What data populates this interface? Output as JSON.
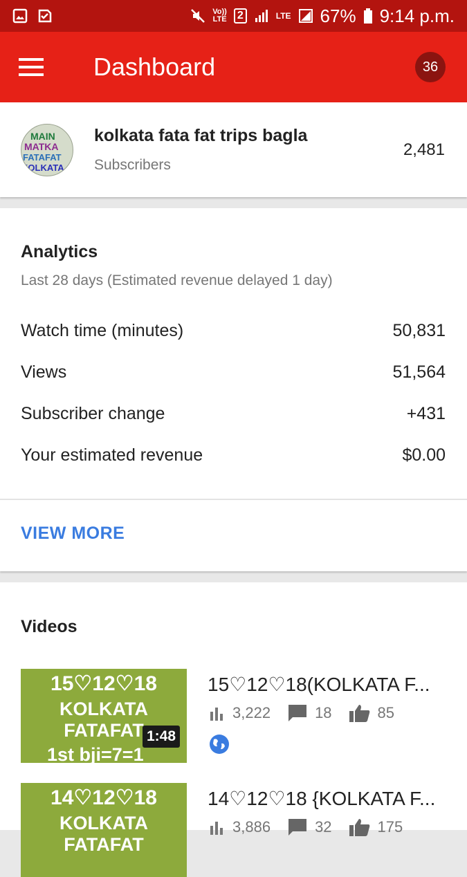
{
  "statusbar": {
    "sim_badge": "2",
    "battery": "67%",
    "time": "9:14 p.m."
  },
  "appbar": {
    "title": "Dashboard",
    "notification_count": "36"
  },
  "channel": {
    "avatar_lines": [
      "MAIN",
      "MATKA",
      "FATAFAT",
      "KOLKATA"
    ],
    "name": "kolkata fata fat trips bagla",
    "subscribers_label": "Subscribers",
    "subscribers_count": "2,481"
  },
  "analytics": {
    "title": "Analytics",
    "subtitle": "Last 28 days (Estimated revenue delayed 1 day)",
    "rows": [
      {
        "label": "Watch time (minutes)",
        "value": "50,831"
      },
      {
        "label": "Views",
        "value": "51,564"
      },
      {
        "label": "Subscriber change",
        "value": "+431"
      },
      {
        "label": "Your estimated revenue",
        "value": "$0.00"
      }
    ],
    "view_more": "VIEW MORE"
  },
  "videos": {
    "title": "Videos",
    "items": [
      {
        "thumb_lines": [
          "15♡12♡18",
          "KOLKATA FATAFAT",
          "1st bji=7=1"
        ],
        "duration": "1:48",
        "title": "15♡12♡18(KOLKATA F...",
        "views": "3,222",
        "comments": "18",
        "likes": "85"
      },
      {
        "thumb_lines": [
          "14♡12♡18",
          "KOLKATA FATAFAT",
          ""
        ],
        "duration": "",
        "title": "14♡12♡18 {KOLKATA F...",
        "views": "3,886",
        "comments": "32",
        "likes": "175"
      }
    ]
  },
  "colors": {
    "statusbar": "#b3140f",
    "appbar": "#e62117",
    "accent_link": "#3a7ce0",
    "thumb_bg": "#8daa3c"
  }
}
